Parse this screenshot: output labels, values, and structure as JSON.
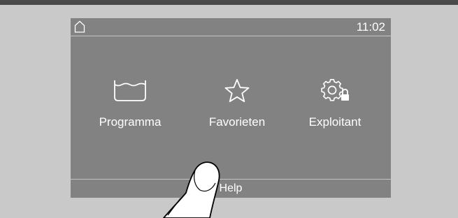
{
  "status_bar": {
    "home_icon": "home-icon",
    "time": "11:02"
  },
  "menu": {
    "items": [
      {
        "label": "Programma",
        "icon": "wash-tub-icon"
      },
      {
        "label": "Favorieten",
        "icon": "star-icon"
      },
      {
        "label": "Exploitant",
        "icon": "gear-lock-icon"
      }
    ]
  },
  "footer": {
    "help_label": "Help"
  },
  "colors": {
    "screen_bg": "#828282",
    "surround_bg": "#c9c9c9",
    "text": "#ffffff"
  }
}
